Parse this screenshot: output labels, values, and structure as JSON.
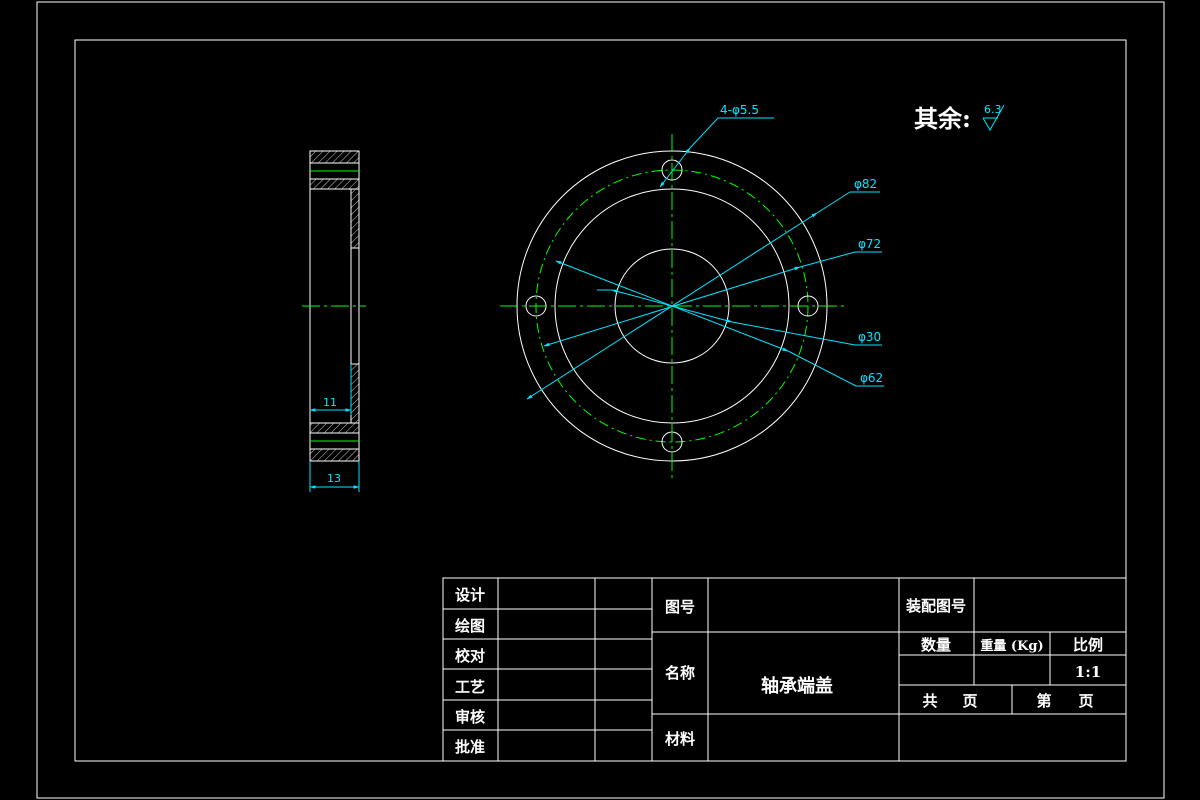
{
  "drawing": {
    "note": "其余:",
    "roughness_value": "6.3",
    "front_view_dimensions": {
      "holes": "4-φ5.5",
      "d_outer": "φ82",
      "d_pitch": "φ72",
      "d_inner": "φ30",
      "d_step": "φ62"
    },
    "side_view_dimensions": {
      "inner_width": "11",
      "total_width": "13"
    }
  },
  "colors": {
    "background": "#000000",
    "outline": "#ffffff",
    "centerline": "#00ff00",
    "dimension": "#00e5ff"
  },
  "title_block": {
    "roles": [
      "设计",
      "绘图",
      "校对",
      "工艺",
      "审核",
      "批准"
    ],
    "drawing_no_label": "图号",
    "name_label": "名称",
    "part_name": "轴承端盖",
    "material_label": "材料",
    "assembly_no_label": "装配图号",
    "quantity_label": "数量",
    "weight_label": "重量 (Kg)",
    "scale_label": "比例",
    "scale_value": "1:1",
    "total_label": "共",
    "sheet_label": "第",
    "page_label": "页"
  }
}
